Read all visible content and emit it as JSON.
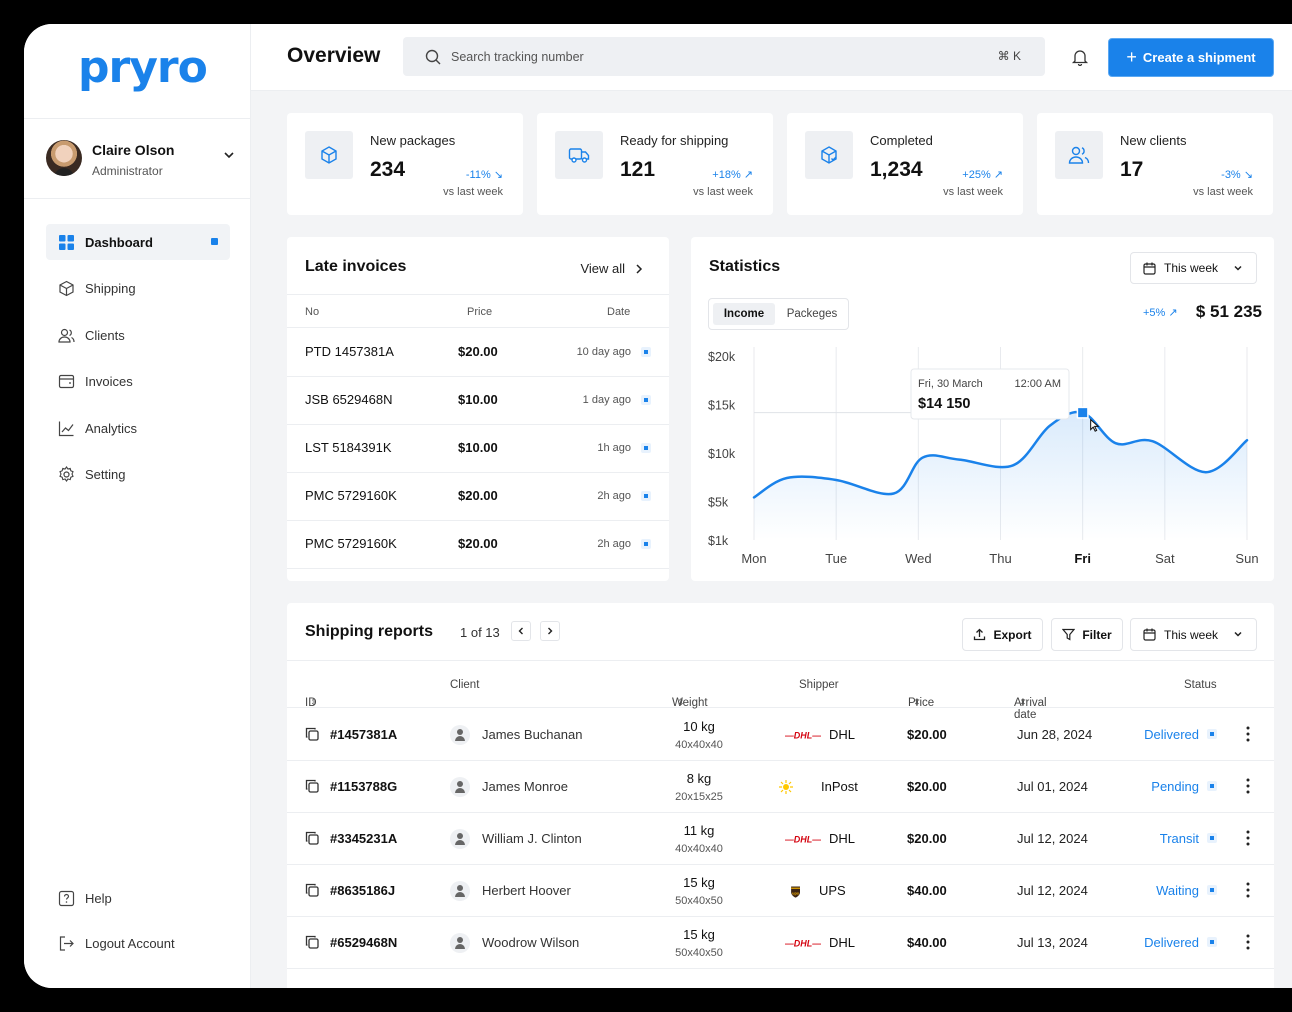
{
  "app": {
    "logo": "pryro"
  },
  "user": {
    "name": "Claire Olson",
    "role": "Administrator"
  },
  "sidebar": {
    "items": [
      {
        "label": "Dashboard",
        "icon": "grid-icon",
        "active": true
      },
      {
        "label": "Shipping",
        "icon": "box-icon"
      },
      {
        "label": "Clients",
        "icon": "users-icon"
      },
      {
        "label": "Invoices",
        "icon": "invoice-icon"
      },
      {
        "label": "Analytics",
        "icon": "chart-line-icon"
      },
      {
        "label": "Setting",
        "icon": "gear-icon"
      }
    ],
    "bottom": [
      {
        "label": "Help",
        "icon": "help-icon"
      },
      {
        "label": "Logout Account",
        "icon": "logout-icon"
      }
    ]
  },
  "header": {
    "title": "Overview",
    "search_placeholder": "Search tracking number",
    "shortcut": "⌘ K",
    "create_label": "Create a shipment"
  },
  "kpis": [
    {
      "label": "New packages",
      "value": "234",
      "delta": "-11% ↘",
      "sub": "vs last week",
      "icon": "box-icon"
    },
    {
      "label": "Ready for shipping",
      "value": "121",
      "delta": "+18% ↗",
      "sub": "vs last week",
      "icon": "truck-icon"
    },
    {
      "label": "Completed",
      "value": "1,234",
      "delta": "+25% ↗",
      "sub": "vs last week",
      "icon": "box-check-icon"
    },
    {
      "label": "New clients",
      "value": "17",
      "delta": "-3% ↘",
      "sub": "vs last week",
      "icon": "users-icon"
    }
  ],
  "invoices": {
    "title": "Late invoices",
    "view_all": "View all",
    "columns": [
      "No",
      "Price",
      "Date"
    ],
    "rows": [
      {
        "no": "PTD 1457381A",
        "price": "$20.00",
        "date": "10 day ago"
      },
      {
        "no": "JSB 6529468N",
        "price": "$10.00",
        "date": "1 day ago"
      },
      {
        "no": "LST 5184391K",
        "price": "$10.00",
        "date": "1h ago"
      },
      {
        "no": "PMC 5729160K",
        "price": "$20.00",
        "date": "2h ago"
      },
      {
        "no": "PMC 5729160K",
        "price": "$20.00",
        "date": "2h ago"
      }
    ]
  },
  "statistics": {
    "title": "Statistics",
    "period": "This week",
    "tabs": [
      "Income",
      "Packeges"
    ],
    "active_tab": "Income",
    "delta": "+5% ↗",
    "total": "$ 51 235",
    "tooltip": {
      "date": "Fri, 30 March",
      "time": "12:00 AM",
      "value": "$14 150"
    }
  },
  "chart_data": {
    "type": "area",
    "x": [
      "Mon",
      "Tue",
      "Wed",
      "Thu",
      "Fri",
      "Sat",
      "Sun"
    ],
    "y_ticks": [
      "$20k",
      "$15k",
      "$10k",
      "$5k",
      "$1k"
    ],
    "y_tick_values": [
      20000,
      15000,
      10000,
      5000,
      1000
    ],
    "ylim": [
      1000,
      20000
    ],
    "highlight": "Fri",
    "color": "#1a82ea",
    "series": [
      {
        "x": [
          0,
          0.4,
          1,
          1.7,
          2.05,
          2.5,
          3.15,
          3.6,
          4.0,
          4.4,
          4.85,
          5.5,
          6.0
        ],
        "y": [
          5400,
          7400,
          7200,
          5800,
          9500,
          9300,
          8700,
          12800,
          14150,
          11000,
          11200,
          8000,
          11300
        ]
      }
    ]
  },
  "reports": {
    "title": "Shipping reports",
    "pager": "1 of 13",
    "export": "Export",
    "filter": "Filter",
    "period": "This week",
    "columns": [
      "ID",
      "Client",
      "Weight",
      "Shipper",
      "Price",
      "Arrival date",
      "Status"
    ],
    "rows": [
      {
        "id": "#1457381A",
        "client": "James Buchanan",
        "weight": "10 kg",
        "dims": "40x40x40",
        "shipper": "DHL",
        "price": "$20.00",
        "date": "Jun 28, 2024",
        "status": "Delivered"
      },
      {
        "id": "#1153788G",
        "client": "James Monroe",
        "weight": "8 kg",
        "dims": "20x15x25",
        "shipper": "InPost",
        "price": "$20.00",
        "date": "Jul 01, 2024",
        "status": "Pending"
      },
      {
        "id": "#3345231A",
        "client": "William J. Clinton",
        "weight": "11 kg",
        "dims": "40x40x40",
        "shipper": "DHL",
        "price": "$20.00",
        "date": "Jul 12, 2024",
        "status": "Transit"
      },
      {
        "id": "#8635186J",
        "client": "Herbert Hoover",
        "weight": "15 kg",
        "dims": "50x40x50",
        "shipper": "UPS",
        "price": "$40.00",
        "date": "Jul 12, 2024",
        "status": "Waiting"
      },
      {
        "id": "#6529468N",
        "client": "Woodrow Wilson",
        "weight": "15 kg",
        "dims": "50x40x50",
        "shipper": "DHL",
        "price": "$40.00",
        "date": "Jul 13, 2024",
        "status": "Delivered"
      }
    ]
  }
}
